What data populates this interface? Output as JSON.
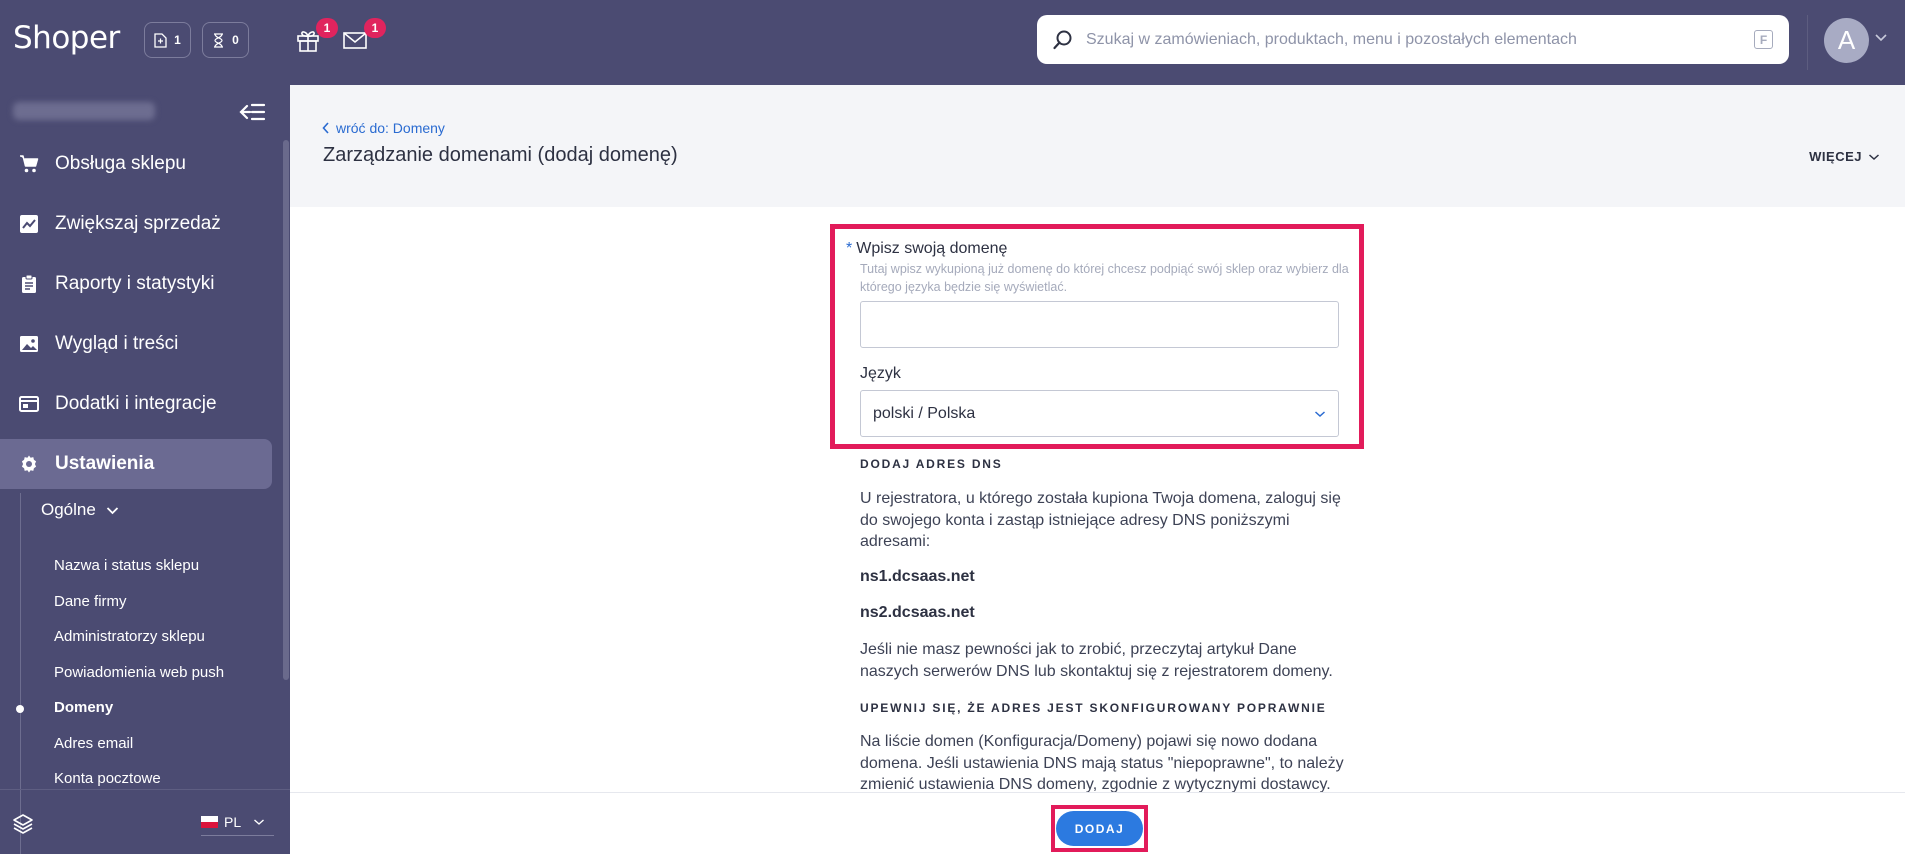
{
  "topbar": {
    "logo": "Shoper",
    "counter_files": "1",
    "counter_pending": "0",
    "gift_badge": "1",
    "mail_badge": "1",
    "search_placeholder": "Szukaj w zamówieniach, produktach, menu i pozostałych elementach",
    "search_shortcut": "F",
    "avatar_letter": "A"
  },
  "sidebar": {
    "nav": [
      {
        "label": "Obsługa sklepu",
        "icon": "cart-icon"
      },
      {
        "label": "Zwiększaj sprzedaż",
        "icon": "chart-icon"
      },
      {
        "label": "Raporty i statystyki",
        "icon": "clipboard-icon"
      },
      {
        "label": "Wygląd i treści",
        "icon": "image-icon"
      },
      {
        "label": "Dodatki i integracje",
        "icon": "window-icon"
      },
      {
        "label": "Ustawienia",
        "icon": "gear-icon",
        "active": true
      }
    ],
    "sub_header": "Ogólne",
    "sub_items": [
      {
        "label": "Nazwa i status sklepu"
      },
      {
        "label": "Dane firmy"
      },
      {
        "label": "Administratorzy sklepu"
      },
      {
        "label": "Powiadomienia web push"
      },
      {
        "label": "Domeny",
        "active": true
      },
      {
        "label": "Adres email"
      },
      {
        "label": "Konta pocztowe"
      }
    ],
    "language": "PL"
  },
  "header": {
    "back_link": "wróć do: Domeny",
    "title": "Zarządzanie domenami (dodaj domenę)",
    "more": "WIĘCEJ"
  },
  "form": {
    "domain_label": "Wpisz swoją domenę",
    "domain_hint": "Tutaj wpisz wykupioną już domenę do której chcesz podpiąć swój sklep oraz wybierz dla którego języka będzie się wyświetlać.",
    "domain_value": "",
    "language_label": "Język",
    "language_value": "polski / Polska"
  },
  "info": {
    "dns_title": "DODAJ ADRES DNS",
    "dns_text": "U rejestratora, u którego została kupiona Twoja domena, zaloguj się do swojego konta i zastąp istniejące adresy DNS poniższymi adresami:",
    "ns1": "ns1.dcsaas.net",
    "ns2": "ns2.dcsaas.net",
    "help_text": "Jeśli nie masz pewności jak to zrobić, przeczytaj artykuł Dane naszych serwerów DNS lub skontaktuj się z rejestratorem domeny.",
    "verify_title": "UPEWNIJ SIĘ, ŻE ADRES JEST SKONFIGUROWANY POPRAWNIE",
    "verify_text": "Na liście domen (Konfiguracja/Domeny) pojawi się nowo dodana domena. Jeśli ustawienia DNS mają status \"niepoprawne\", to należy zmienić ustawienia DNS domeny, zgodnie z wytycznymi dostawcy."
  },
  "footer": {
    "add_button": "DODAJ"
  },
  "colors": {
    "sidebar_bg": "#4b4b72",
    "active_nav_bg": "#6b6a92",
    "accent_blue": "#2c7ae0",
    "highlight_red": "#e21b5a",
    "badge_red": "#e0245e"
  }
}
